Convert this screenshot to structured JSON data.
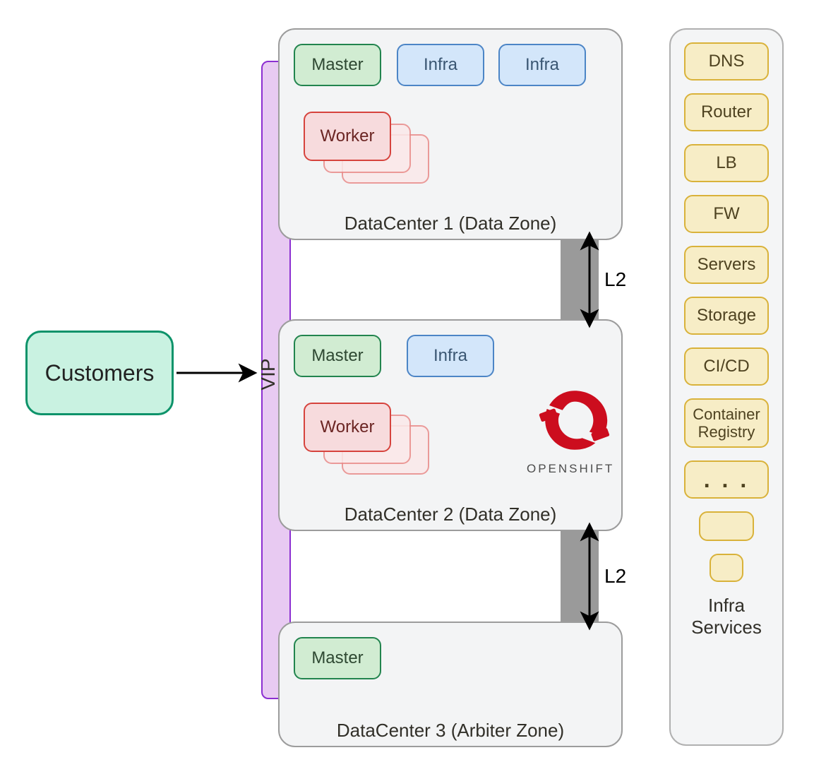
{
  "customers_label": "Customers",
  "vip_label": "VIP",
  "datacenters": [
    {
      "caption": "DataCenter 1 (Data Zone)",
      "master": "Master",
      "infra1": "Infra",
      "infra2": "Infra",
      "worker": "Worker"
    },
    {
      "caption": "DataCenter 2 (Data Zone)",
      "master": "Master",
      "infra1": "Infra",
      "worker": "Worker"
    },
    {
      "caption": "DataCenter 3 (Arbiter Zone)",
      "master": "Master"
    }
  ],
  "links": {
    "l2_upper": "L2",
    "l2_lower": "L2"
  },
  "openshift_label": "OPENSHIFT",
  "services": {
    "items": [
      "DNS",
      "Router",
      "LB",
      "FW",
      "Servers",
      "Storage",
      "CI/CD",
      "Container Registry"
    ],
    "ellipsis": ". . .",
    "caption": "Infra Services"
  },
  "colors": {
    "master_fill": "#d1ecd2",
    "master_border": "#22844e",
    "infra_fill": "#d3e6fa",
    "infra_border": "#4c85c6",
    "worker_fill": "#f7dbdd",
    "worker_border": "#d6433d",
    "customers_fill": "#c9f2e1",
    "customers_border": "#0d936a",
    "vip_fill": "#e8caf2",
    "vip_border": "#8c2fd1",
    "svc_fill": "#f7edc6",
    "svc_border": "#d9b23a",
    "grey_col": "#9a9a9a",
    "openshift_red": "#cc0d1e"
  }
}
